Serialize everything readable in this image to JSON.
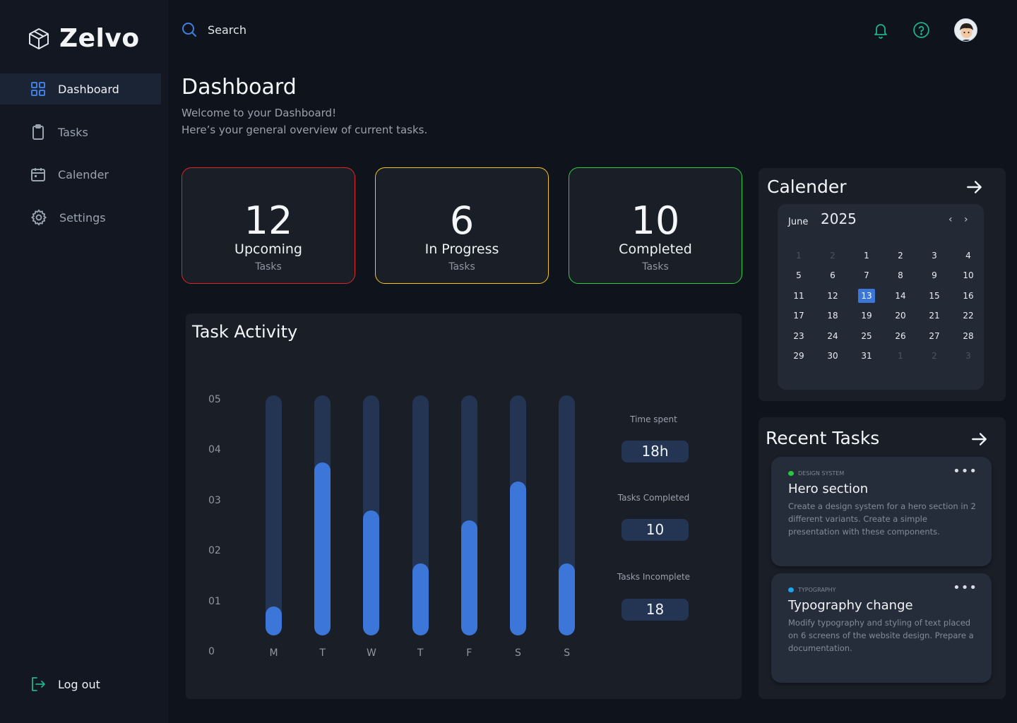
{
  "app": {
    "name": "Zelvo"
  },
  "sidebar": {
    "items": [
      {
        "label": "Dashboard",
        "icon": "grid-icon",
        "active": true
      },
      {
        "label": "Tasks",
        "icon": "clipboard-icon",
        "active": false
      },
      {
        "label": "Calender",
        "icon": "calendar-icon",
        "active": false
      },
      {
        "label": "Settings",
        "icon": "gear-icon",
        "active": false
      }
    ],
    "logout_label": "Log out"
  },
  "search": {
    "placeholder": "Search"
  },
  "header": {
    "icons": [
      "bell-icon",
      "help-icon",
      "avatar"
    ]
  },
  "page": {
    "title": "Dashboard",
    "subtitle_line1": "Welcome to your Dashboard!",
    "subtitle_line2": "Here’s your general overview of current tasks."
  },
  "stats": [
    {
      "value": "12",
      "label": "Upcoming",
      "sub": "Tasks",
      "color": "#e02424"
    },
    {
      "value": "6",
      "label": "In Progress",
      "sub": "Tasks",
      "color": "#f5c518"
    },
    {
      "value": "10",
      "label": "Completed",
      "sub": "Tasks",
      "color": "#27d13d"
    }
  ],
  "activity": {
    "title": "Task Activity",
    "metrics": [
      {
        "title": "Time spent",
        "value": "18h"
      },
      {
        "title": "Tasks Completed",
        "value": "10"
      },
      {
        "title": "Tasks Incomplete",
        "value": "18"
      }
    ]
  },
  "chart_data": {
    "type": "bar",
    "categories": [
      "M",
      "T",
      "W",
      "T",
      "F",
      "S",
      "S"
    ],
    "values": [
      0.6,
      3.6,
      2.6,
      1.5,
      2.4,
      3.2,
      1.5
    ],
    "ylim": [
      0,
      5
    ],
    "yticks": [
      "0",
      "01",
      "02",
      "03",
      "04",
      "05"
    ],
    "title": "",
    "xlabel": "",
    "ylabel": "",
    "colors": {
      "fill": "#3b76d8",
      "track": "#233552"
    }
  },
  "calendar": {
    "title": "Calender",
    "month": "June",
    "year": "2025",
    "prev": "‹",
    "next": "›",
    "weeks": [
      [
        "1",
        "2",
        "1",
        "2",
        "3",
        "4"
      ],
      [
        "5",
        "6",
        "7",
        "8",
        "9",
        "10"
      ],
      [
        "11",
        "12",
        "13",
        "14",
        "15",
        "16"
      ],
      [
        "17",
        "18",
        "19",
        "20",
        "21",
        "22"
      ],
      [
        "23",
        "24",
        "25",
        "26",
        "27",
        "28"
      ],
      [
        "29",
        "30",
        "31",
        "1",
        "2",
        "3"
      ]
    ],
    "muted": [
      [
        0,
        0
      ],
      [
        0,
        1
      ],
      [
        5,
        3
      ],
      [
        5,
        4
      ],
      [
        5,
        5
      ]
    ],
    "selected": [
      2,
      2
    ]
  },
  "recent": {
    "title": "Recent Tasks",
    "tasks": [
      {
        "tag": "DESIGN SYSTEM",
        "tag_color": "#27c93f",
        "title": "Hero section",
        "desc": "Create a design system for a hero section in 2 different variants. Create a simple presentation with these components."
      },
      {
        "tag": "TYPOGRAPHY",
        "tag_color": "#1fa3f0",
        "title": "Typography change",
        "desc": "Modify typography and styling of text placed on 6 screens of the website design. Prepare a documentation."
      }
    ]
  }
}
